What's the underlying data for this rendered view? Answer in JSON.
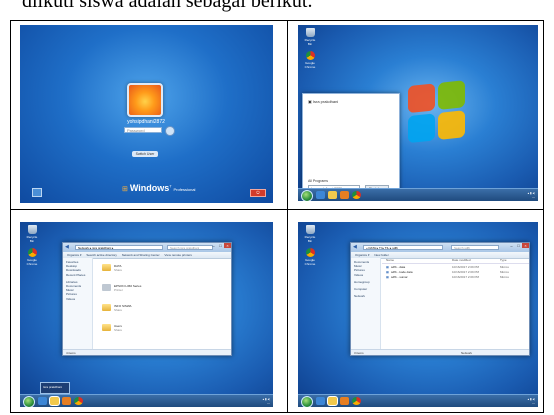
{
  "caption": "diikuti siswa adalah sebagai berikut.",
  "panel1": {
    "user_name": "yohsipdhani2872",
    "password_placeholder": "Password",
    "switch_user": "Switch User",
    "windows_logo_text": "Windows",
    "windows_edition": "Professional"
  },
  "panel2": {
    "recycle_bin": "Recycle Bin",
    "chrome": "Google Chrome",
    "start_item": "Isra prakdhani",
    "all_programs": "All Programs",
    "search_value": "Isra prakdhani 2872",
    "shutdown": "Shut down"
  },
  "panel3": {
    "recycle_bin": "Recycle Bin",
    "chrome": "Google Chrome",
    "breadcrumb": "Network ▸ isra prakdhani ▸",
    "search_placeholder": "Search isra prakdhani",
    "toolbar": [
      "Organize ▾",
      "Search active directory",
      "Network and Sharing Center",
      "View remote printers"
    ],
    "nav": [
      "Favorites",
      "Desktop",
      "Downloads",
      "Recent Places",
      "",
      "Libraries",
      "Documents",
      "Music",
      "Pictures",
      "Videos"
    ],
    "items": [
      {
        "name": "DATA",
        "type": "Share"
      },
      {
        "name": "EPSON L360 Series",
        "type": "Printer"
      },
      {
        "name": "INFO SISWA",
        "type": "Share"
      },
      {
        "name": "Users",
        "type": "Share"
      }
    ],
    "status": "4 items",
    "taskbar_popup": "Isra prakdhani"
  },
  "panel4": {
    "recycle_bin": "Recycle Bin",
    "chrome": "Google Chrome",
    "breadcrumb": "« DATA ▸ TI ▸ TIL ▸ sdfb",
    "search_placeholder": "Search sdfb",
    "toolbar": [
      "Organize ▾",
      "New folder"
    ],
    "columns": [
      "Name",
      "Date modified",
      "Type"
    ],
    "nav": [
      "Documents",
      "Music",
      "Pictures",
      "Videos",
      "",
      "Homegroup",
      "",
      "Computer",
      "",
      "Network"
    ],
    "files": [
      {
        "name": "sdfb - data",
        "date": "10/16/2017 2:09 PM",
        "type": "Micros"
      },
      {
        "name": "sdfb - kode data",
        "date": "10/16/2017 2:09 PM",
        "type": "Micros"
      },
      {
        "name": "sdfb - sumar",
        "date": "10/16/2017 2:09 PM",
        "type": "Micros"
      }
    ],
    "status_left": "3 items",
    "status_right": "Network"
  },
  "colors": {
    "desktop_blue": "#1f6fc8",
    "taskbar": "#1f4a7e",
    "folder_yellow": "#f2c94c"
  }
}
